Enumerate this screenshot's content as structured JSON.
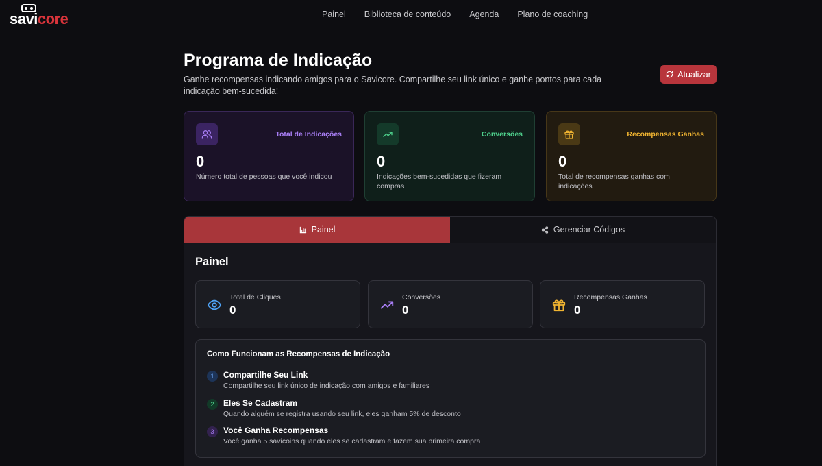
{
  "brand": {
    "part1": "savi",
    "part2": "core",
    "accent": "#d9343b"
  },
  "nav": {
    "items": [
      "Painel",
      "Biblioteca de conteúdo",
      "Agenda",
      "Plano de coaching"
    ]
  },
  "header": {
    "title": "Programa de Indicação",
    "subtitle": "Ganhe recompensas indicando amigos para o Savicore. Compartilhe seu link único e ganhe pontos para cada indicação bem-sucedida!",
    "refresh_label": "Atualizar",
    "refresh_icon": "refresh-icon"
  },
  "stats": [
    {
      "label": "Total de Indicações",
      "value": "0",
      "desc": "Número total de pessoas que você indicou",
      "icon": "users-icon",
      "color": "#a87ef5"
    },
    {
      "label": "Conversões",
      "value": "0",
      "desc": "Indicações bem-sucedidas que fizeram compras",
      "icon": "trending-up-icon",
      "color": "#4ed08c"
    },
    {
      "label": "Recompensas Ganhas",
      "value": "0",
      "desc": "Total de recompensas ganhas com indicações",
      "icon": "gift-icon",
      "color": "#f0b431"
    }
  ],
  "tabs": [
    {
      "label": "Painel",
      "icon": "bar-chart-icon"
    },
    {
      "label": "Gerenciar Códigos",
      "icon": "share-icon"
    }
  ],
  "panel": {
    "title": "Painel",
    "metrics": [
      {
        "label": "Total de Cliques",
        "value": "0",
        "icon": "eye-icon",
        "color": "#4fa3f7"
      },
      {
        "label": "Conversões",
        "value": "0",
        "icon": "trending-up-icon",
        "color": "#a87ef5"
      },
      {
        "label": "Recompensas Ganhas",
        "value": "0",
        "icon": "gift-icon",
        "color": "#f0b431"
      }
    ],
    "how": {
      "title": "Como Funcionam as Recompensas de Indicação",
      "steps": [
        {
          "num": "1",
          "title": "Compartilhe Seu Link",
          "desc": "Compartilhe seu link único de indicação com amigos e familiares"
        },
        {
          "num": "2",
          "title": "Eles Se Cadastram",
          "desc": "Quando alguém se registra usando seu link, eles ganham 5% de desconto"
        },
        {
          "num": "3",
          "title": "Você Ganha Recompensas",
          "desc": "Você ganha 5 savicoins quando eles se cadastram e fazem sua primeira compra"
        }
      ]
    }
  }
}
